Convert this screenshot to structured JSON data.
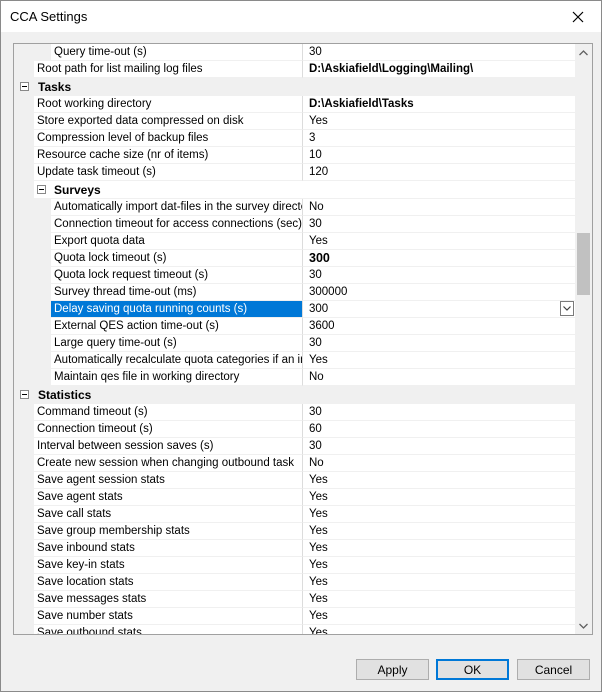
{
  "window": {
    "title": "CCA Settings"
  },
  "grid_rows": [
    {
      "kind": "prop",
      "level": 2,
      "name": "Query time-out (s)",
      "value": "30"
    },
    {
      "kind": "prop",
      "level": 1,
      "name": "Root path for list mailing log files",
      "value": "D:\\Askiafield\\Logging\\Mailing\\",
      "style": "bold"
    },
    {
      "kind": "cat",
      "name": "Tasks"
    },
    {
      "kind": "prop",
      "level": 1,
      "name": "Root working directory",
      "value": "D:\\Askiafield\\Tasks",
      "style": "bold"
    },
    {
      "kind": "prop",
      "level": 1,
      "name": "Store exported data compressed on disk",
      "value": "Yes"
    },
    {
      "kind": "prop",
      "level": 1,
      "name": "Compression level of backup files",
      "value": "3"
    },
    {
      "kind": "prop",
      "level": 1,
      "name": "Resource cache size (nr of items)",
      "value": "10"
    },
    {
      "kind": "prop",
      "level": 1,
      "name": "Update task timeout (s)",
      "value": "120"
    },
    {
      "kind": "subcat",
      "name": "Surveys"
    },
    {
      "kind": "prop",
      "level": 2,
      "name": "Automatically import dat-files in the survey director...",
      "value": "No"
    },
    {
      "kind": "prop",
      "level": 2,
      "name": "Connection timeout for access connections (sec)",
      "value": "30"
    },
    {
      "kind": "prop",
      "level": 2,
      "name": "Export quota data",
      "value": "Yes"
    },
    {
      "kind": "prop",
      "level": 2,
      "name": "Quota lock timeout (s)",
      "value": "300",
      "style": "boldbig"
    },
    {
      "kind": "prop",
      "level": 2,
      "name": "Quota lock request timeout (s)",
      "value": "30"
    },
    {
      "kind": "prop",
      "level": 2,
      "name": "Survey thread time-out (ms)",
      "value": "300000"
    },
    {
      "kind": "prop",
      "level": 2,
      "name": "Delay saving quota running counts (s)",
      "value": "300",
      "selected": true
    },
    {
      "kind": "prop",
      "level": 2,
      "name": "External QES action time-out (s)",
      "value": "3600"
    },
    {
      "kind": "prop",
      "level": 2,
      "name": "Large query time-out (s)",
      "value": "30"
    },
    {
      "kind": "prop",
      "level": 2,
      "name": "Automatically recalculate quota categories if an in...",
      "value": "Yes"
    },
    {
      "kind": "prop",
      "level": 2,
      "name": "Maintain qes file in working directory",
      "value": "No"
    },
    {
      "kind": "cat",
      "name": "Statistics"
    },
    {
      "kind": "prop",
      "level": 1,
      "name": "Command timeout (s)",
      "value": "30"
    },
    {
      "kind": "prop",
      "level": 1,
      "name": "Connection timeout (s)",
      "value": "60"
    },
    {
      "kind": "prop",
      "level": 1,
      "name": "Interval between session saves (s)",
      "value": "30"
    },
    {
      "kind": "prop",
      "level": 1,
      "name": "Create new session when changing outbound task",
      "value": "No"
    },
    {
      "kind": "prop",
      "level": 1,
      "name": "Save agent session stats",
      "value": "Yes"
    },
    {
      "kind": "prop",
      "level": 1,
      "name": "Save agent stats",
      "value": "Yes"
    },
    {
      "kind": "prop",
      "level": 1,
      "name": "Save call stats",
      "value": "Yes"
    },
    {
      "kind": "prop",
      "level": 1,
      "name": "Save group membership stats",
      "value": "Yes"
    },
    {
      "kind": "prop",
      "level": 1,
      "name": "Save inbound stats",
      "value": "Yes"
    },
    {
      "kind": "prop",
      "level": 1,
      "name": "Save key-in stats",
      "value": "Yes"
    },
    {
      "kind": "prop",
      "level": 1,
      "name": "Save location stats",
      "value": "Yes"
    },
    {
      "kind": "prop",
      "level": 1,
      "name": "Save messages stats",
      "value": "Yes"
    },
    {
      "kind": "prop",
      "level": 1,
      "name": "Save number stats",
      "value": "Yes"
    },
    {
      "kind": "prop",
      "level": 1,
      "name": "Save outbound stats",
      "value": "Yes"
    }
  ],
  "scrollbar": {
    "thumb_position": 0.31,
    "thumb_size": 0.11
  },
  "buttons": {
    "apply": "Apply",
    "ok": "OK",
    "cancel": "Cancel"
  },
  "icons": {
    "close": "close-icon",
    "collapse": "minus-icon",
    "dropdown": "chevron-down-icon",
    "scroll_up": "scroll-up-arrow-icon",
    "scroll_down": "scroll-down-arrow-icon"
  }
}
